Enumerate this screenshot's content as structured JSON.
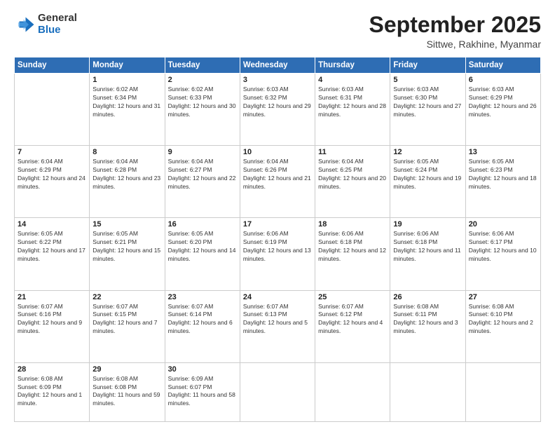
{
  "header": {
    "logo": {
      "general": "General",
      "blue": "Blue"
    },
    "title": "September 2025",
    "location": "Sittwe, Rakhine, Myanmar"
  },
  "weekdays": [
    "Sunday",
    "Monday",
    "Tuesday",
    "Wednesday",
    "Thursday",
    "Friday",
    "Saturday"
  ],
  "weeks": [
    [
      {
        "day": null
      },
      {
        "day": "1",
        "sunrise": "6:02 AM",
        "sunset": "6:34 PM",
        "daylight": "12 hours and 31 minutes."
      },
      {
        "day": "2",
        "sunrise": "6:02 AM",
        "sunset": "6:33 PM",
        "daylight": "12 hours and 30 minutes."
      },
      {
        "day": "3",
        "sunrise": "6:03 AM",
        "sunset": "6:32 PM",
        "daylight": "12 hours and 29 minutes."
      },
      {
        "day": "4",
        "sunrise": "6:03 AM",
        "sunset": "6:31 PM",
        "daylight": "12 hours and 28 minutes."
      },
      {
        "day": "5",
        "sunrise": "6:03 AM",
        "sunset": "6:30 PM",
        "daylight": "12 hours and 27 minutes."
      },
      {
        "day": "6",
        "sunrise": "6:03 AM",
        "sunset": "6:29 PM",
        "daylight": "12 hours and 26 minutes."
      }
    ],
    [
      {
        "day": "7",
        "sunrise": "6:04 AM",
        "sunset": "6:29 PM",
        "daylight": "12 hours and 24 minutes."
      },
      {
        "day": "8",
        "sunrise": "6:04 AM",
        "sunset": "6:28 PM",
        "daylight": "12 hours and 23 minutes."
      },
      {
        "day": "9",
        "sunrise": "6:04 AM",
        "sunset": "6:27 PM",
        "daylight": "12 hours and 22 minutes."
      },
      {
        "day": "10",
        "sunrise": "6:04 AM",
        "sunset": "6:26 PM",
        "daylight": "12 hours and 21 minutes."
      },
      {
        "day": "11",
        "sunrise": "6:04 AM",
        "sunset": "6:25 PM",
        "daylight": "12 hours and 20 minutes."
      },
      {
        "day": "12",
        "sunrise": "6:05 AM",
        "sunset": "6:24 PM",
        "daylight": "12 hours and 19 minutes."
      },
      {
        "day": "13",
        "sunrise": "6:05 AM",
        "sunset": "6:23 PM",
        "daylight": "12 hours and 18 minutes."
      }
    ],
    [
      {
        "day": "14",
        "sunrise": "6:05 AM",
        "sunset": "6:22 PM",
        "daylight": "12 hours and 17 minutes."
      },
      {
        "day": "15",
        "sunrise": "6:05 AM",
        "sunset": "6:21 PM",
        "daylight": "12 hours and 15 minutes."
      },
      {
        "day": "16",
        "sunrise": "6:05 AM",
        "sunset": "6:20 PM",
        "daylight": "12 hours and 14 minutes."
      },
      {
        "day": "17",
        "sunrise": "6:06 AM",
        "sunset": "6:19 PM",
        "daylight": "12 hours and 13 minutes."
      },
      {
        "day": "18",
        "sunrise": "6:06 AM",
        "sunset": "6:18 PM",
        "daylight": "12 hours and 12 minutes."
      },
      {
        "day": "19",
        "sunrise": "6:06 AM",
        "sunset": "6:18 PM",
        "daylight": "12 hours and 11 minutes."
      },
      {
        "day": "20",
        "sunrise": "6:06 AM",
        "sunset": "6:17 PM",
        "daylight": "12 hours and 10 minutes."
      }
    ],
    [
      {
        "day": "21",
        "sunrise": "6:07 AM",
        "sunset": "6:16 PM",
        "daylight": "12 hours and 9 minutes."
      },
      {
        "day": "22",
        "sunrise": "6:07 AM",
        "sunset": "6:15 PM",
        "daylight": "12 hours and 7 minutes."
      },
      {
        "day": "23",
        "sunrise": "6:07 AM",
        "sunset": "6:14 PM",
        "daylight": "12 hours and 6 minutes."
      },
      {
        "day": "24",
        "sunrise": "6:07 AM",
        "sunset": "6:13 PM",
        "daylight": "12 hours and 5 minutes."
      },
      {
        "day": "25",
        "sunrise": "6:07 AM",
        "sunset": "6:12 PM",
        "daylight": "12 hours and 4 minutes."
      },
      {
        "day": "26",
        "sunrise": "6:08 AM",
        "sunset": "6:11 PM",
        "daylight": "12 hours and 3 minutes."
      },
      {
        "day": "27",
        "sunrise": "6:08 AM",
        "sunset": "6:10 PM",
        "daylight": "12 hours and 2 minutes."
      }
    ],
    [
      {
        "day": "28",
        "sunrise": "6:08 AM",
        "sunset": "6:09 PM",
        "daylight": "12 hours and 1 minute."
      },
      {
        "day": "29",
        "sunrise": "6:08 AM",
        "sunset": "6:08 PM",
        "daylight": "11 hours and 59 minutes."
      },
      {
        "day": "30",
        "sunrise": "6:09 AM",
        "sunset": "6:07 PM",
        "daylight": "11 hours and 58 minutes."
      },
      {
        "day": null
      },
      {
        "day": null
      },
      {
        "day": null
      },
      {
        "day": null
      }
    ]
  ]
}
